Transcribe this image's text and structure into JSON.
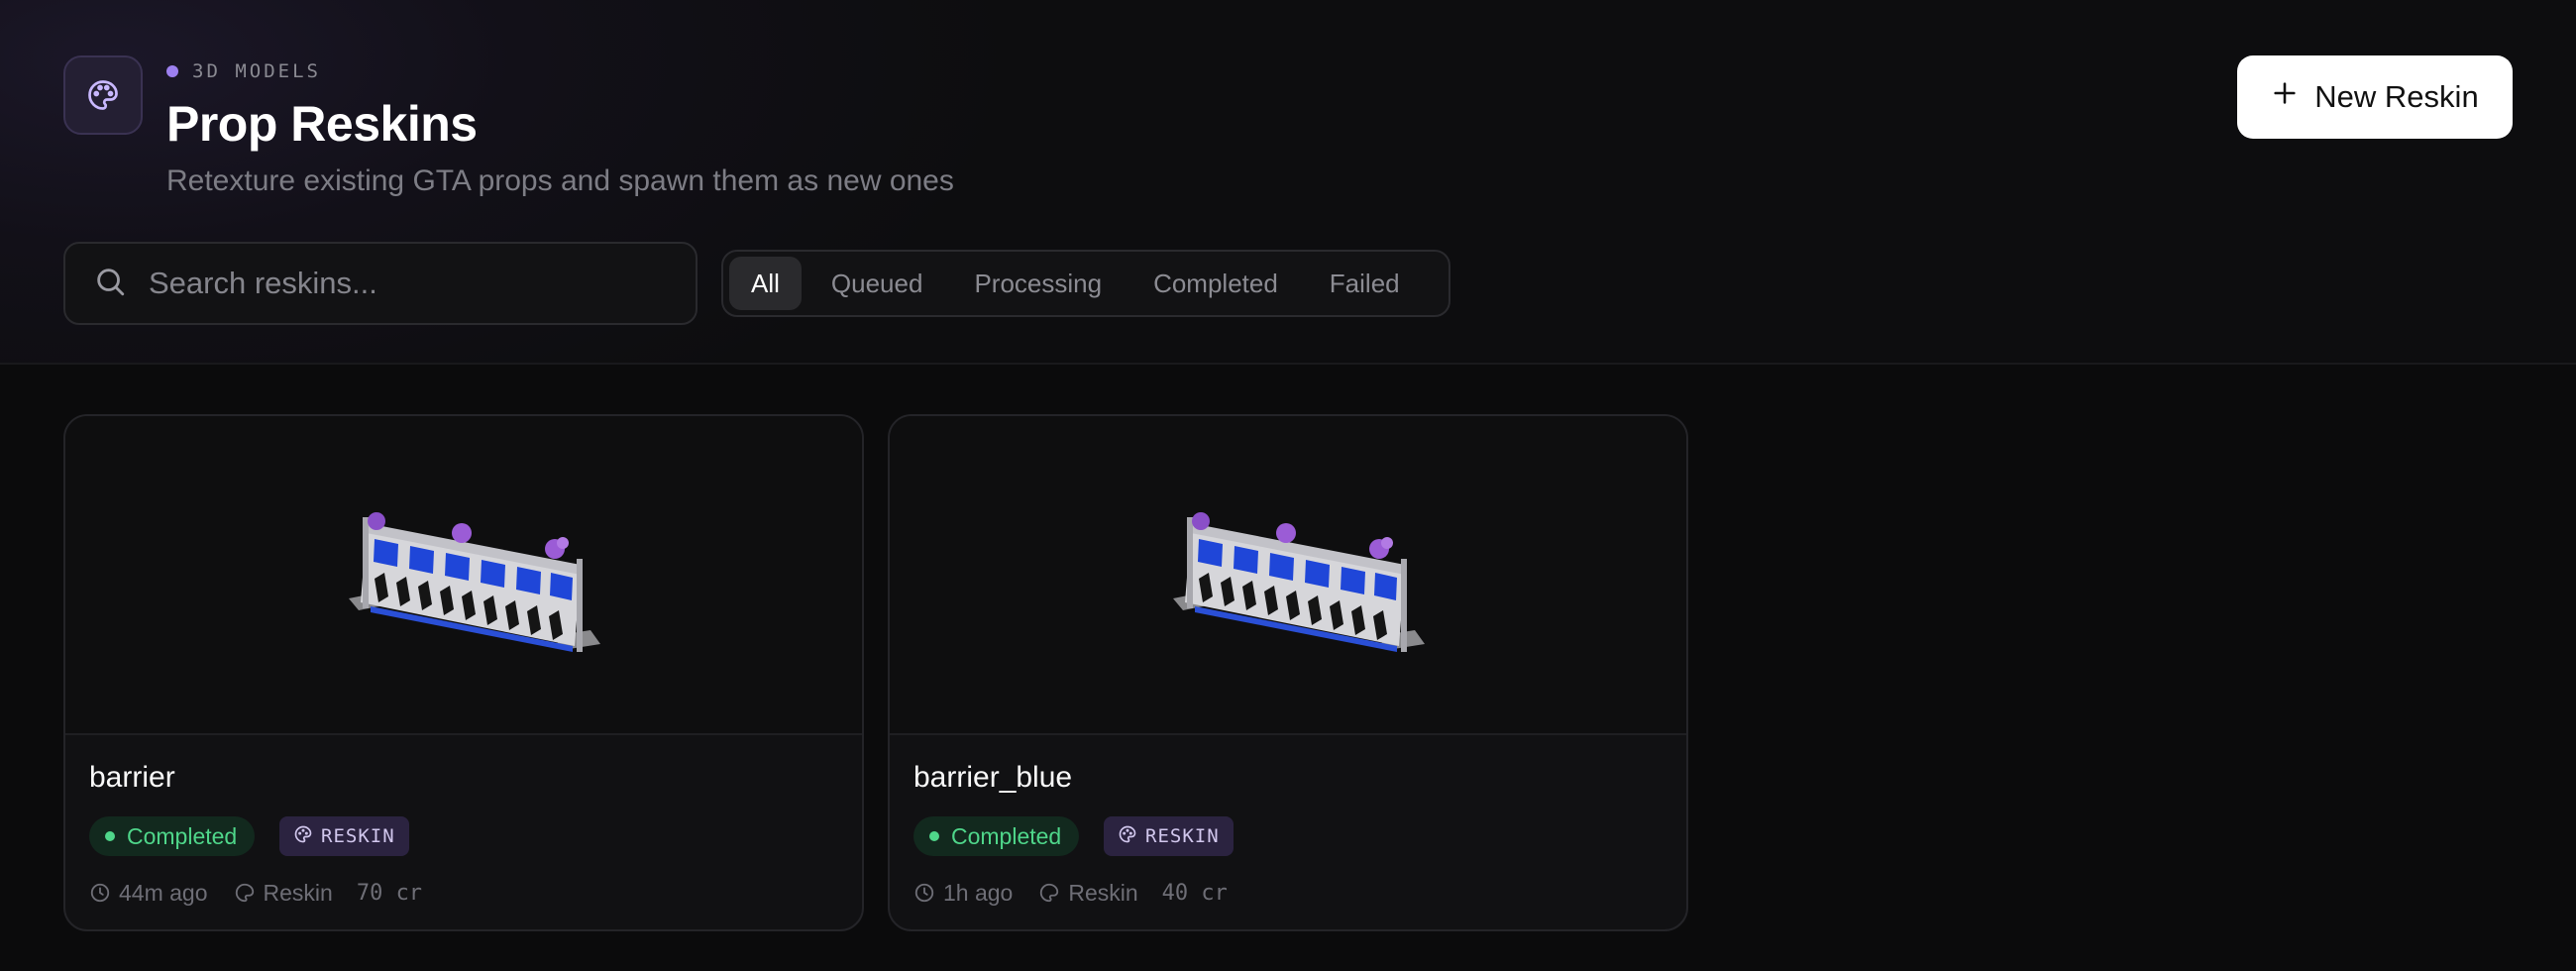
{
  "header": {
    "eyebrow": "3D MODELS",
    "title": "Prop Reskins",
    "subtitle": "Retexture existing GTA props and spawn them as new ones",
    "new_button_label": "New Reskin",
    "icon": "palette-icon",
    "accent_color": "#9d80f0"
  },
  "search": {
    "placeholder": "Search reskins...",
    "value": ""
  },
  "filters": {
    "tabs": [
      "All",
      "Queued",
      "Processing",
      "Completed",
      "Failed"
    ],
    "active": "All"
  },
  "cards": [
    {
      "name": "barrier",
      "status": "Completed",
      "type": "RESKIN",
      "time": "44m ago",
      "kind": "Reskin",
      "credits": "70 cr",
      "thumbnail": "striped-barrier-prop"
    },
    {
      "name": "barrier_blue",
      "status": "Completed",
      "type": "RESKIN",
      "time": "1h ago",
      "kind": "Reskin",
      "credits": "40 cr",
      "thumbnail": "striped-barrier-prop"
    }
  ],
  "colors": {
    "status_completed": "#4fd68a",
    "badge_reskin_bg": "#2b2340"
  }
}
